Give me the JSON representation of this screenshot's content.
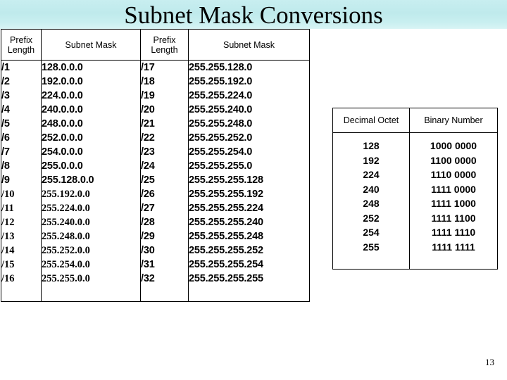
{
  "slide": {
    "title": "Subnet Mask Conversions",
    "page_number": "13",
    "title_band_color": "#c3ecee"
  },
  "main_table": {
    "headers": {
      "prefix_length_1": "Prefix Length",
      "subnet_mask_1": "Subnet Mask",
      "prefix_length_2": "Prefix Length",
      "subnet_mask_2": "Subnet Mask"
    },
    "rows": [
      {
        "prefix_a": "/1",
        "mask_a": "128.0.0.0",
        "style_a": "sans",
        "prefix_b": "/17",
        "mask_b": "255.255.128.0",
        "style_b": "sans"
      },
      {
        "prefix_a": "/2",
        "mask_a": "192.0.0.0",
        "style_a": "sans",
        "prefix_b": "/18",
        "mask_b": "255.255.192.0",
        "style_b": "sans"
      },
      {
        "prefix_a": "/3",
        "mask_a": "224.0.0.0",
        "style_a": "sans",
        "prefix_b": "/19",
        "mask_b": "255.255.224.0",
        "style_b": "sans"
      },
      {
        "prefix_a": "/4",
        "mask_a": "240.0.0.0",
        "style_a": "sans",
        "prefix_b": "/20",
        "mask_b": "255.255.240.0",
        "style_b": "sans"
      },
      {
        "prefix_a": "/5",
        "mask_a": "248.0.0.0",
        "style_a": "sans",
        "prefix_b": "/21",
        "mask_b": "255.255.248.0",
        "style_b": "sans"
      },
      {
        "prefix_a": "/6",
        "mask_a": "252.0.0.0",
        "style_a": "sans",
        "prefix_b": "/22",
        "mask_b": "255.255.252.0",
        "style_b": "sans"
      },
      {
        "prefix_a": "/7",
        "mask_a": "254.0.0.0",
        "style_a": "sans",
        "prefix_b": "/23",
        "mask_b": "255.255.254.0",
        "style_b": "sans"
      },
      {
        "prefix_a": "/8",
        "mask_a": "255.0.0.0",
        "style_a": "sans",
        "prefix_b": "/24",
        "mask_b": "255.255.255.0",
        "style_b": "sans"
      },
      {
        "prefix_a": "/9",
        "mask_a": "255.128.0.0",
        "style_a": "sans",
        "prefix_b": "/25",
        "mask_b": "255.255.255.128",
        "style_b": "sans"
      },
      {
        "prefix_a": "/10",
        "mask_a": "255.192.0.0",
        "style_a": "serif",
        "prefix_b": "/26",
        "mask_b": "255.255.255.192",
        "style_b": "sans"
      },
      {
        "prefix_a": "/11",
        "mask_a": "255.224.0.0",
        "style_a": "serif",
        "prefix_b": "/27",
        "mask_b": "255.255.255.224",
        "style_b": "sans"
      },
      {
        "prefix_a": "/12",
        "mask_a": "255.240.0.0",
        "style_a": "serif",
        "prefix_b": "/28",
        "mask_b": "255.255.255.240",
        "style_b": "sans"
      },
      {
        "prefix_a": "/13",
        "mask_a": "255.248.0.0",
        "style_a": "serif",
        "prefix_b": "/29",
        "mask_b": "255.255.255.248",
        "style_b": "sans"
      },
      {
        "prefix_a": "/14",
        "mask_a": "255.252.0.0",
        "style_a": "serif",
        "prefix_b": "/30",
        "mask_b": "255.255.255.252",
        "style_b": "sans"
      },
      {
        "prefix_a": "/15",
        "mask_a": "255.254.0.0",
        "style_a": "serif",
        "prefix_b": "/31",
        "mask_b": "255.255.255.254",
        "style_b": "sans"
      },
      {
        "prefix_a": "/16",
        "mask_a": "255.255.0.0",
        "style_a": "serif",
        "prefix_b": "/32",
        "mask_b": "255.255.255.255",
        "style_b": "sans"
      }
    ]
  },
  "octet_table": {
    "headers": {
      "decimal_octet": "Decimal Octet",
      "binary_number": "Binary Number"
    },
    "rows": [
      {
        "decimal": "128",
        "binary": "1000 0000"
      },
      {
        "decimal": "192",
        "binary": "1100 0000"
      },
      {
        "decimal": "224",
        "binary": "1110 0000"
      },
      {
        "decimal": "240",
        "binary": "1111 0000"
      },
      {
        "decimal": "248",
        "binary": "1111 1000"
      },
      {
        "decimal": "252",
        "binary": "1111 1100"
      },
      {
        "decimal": "254",
        "binary": "1111 1110"
      },
      {
        "decimal": "255",
        "binary": "1111 1111"
      }
    ]
  }
}
